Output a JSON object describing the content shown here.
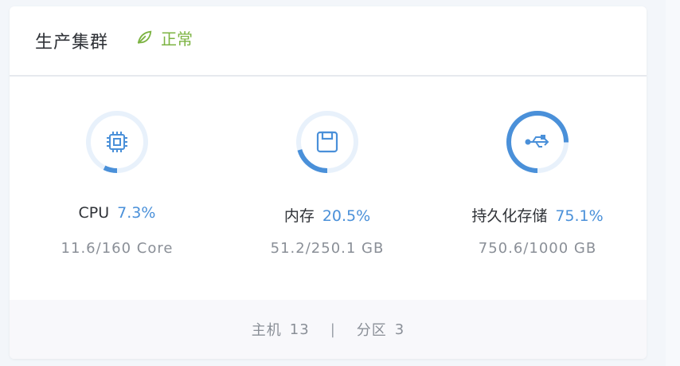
{
  "cluster": {
    "name": "生产集群",
    "status": "正常"
  },
  "colors": {
    "accent": "#4a90d9",
    "ring_track": "#e8f1fb",
    "status_green": "#7cb342"
  },
  "metrics": [
    {
      "icon": "cpu-icon",
      "label": "CPU",
      "percent_text": "7.3%",
      "usage_text": "11.6/160 Core",
      "fraction": 0.073
    },
    {
      "icon": "memory-icon",
      "label": "内存",
      "percent_text": "20.5%",
      "usage_text": "51.2/250.1 GB",
      "fraction": 0.205
    },
    {
      "icon": "storage-icon",
      "label": "持久化存储",
      "percent_text": "75.1%",
      "usage_text": "750.6/1000 GB",
      "fraction": 0.751
    }
  ],
  "footer": {
    "hosts_label": "主机",
    "hosts_count": "13",
    "separator": "|",
    "partitions_label": "分区",
    "partitions_count": "3"
  }
}
